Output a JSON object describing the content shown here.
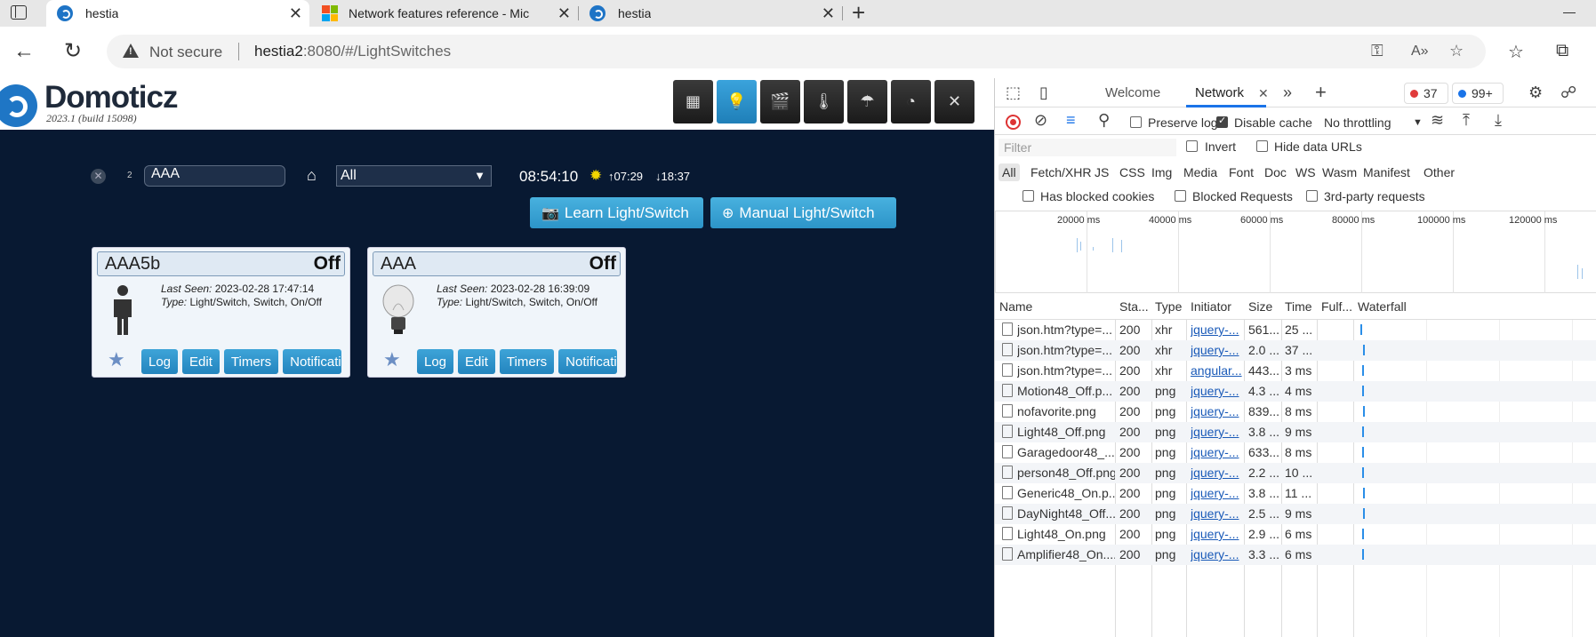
{
  "browser": {
    "tabs": [
      {
        "title": "hestia",
        "active": true
      },
      {
        "title": "Network features reference - Mic",
        "active": false
      },
      {
        "title": "hestia",
        "active": false
      }
    ],
    "security_label": "Not secure",
    "url_host": "hestia2",
    "url_rest": ":8080/#/LightSwitches"
  },
  "app": {
    "brand": "Domoticz",
    "version": "2023.1 (build 15098)",
    "filter": {
      "count": "2",
      "search_value": "AAA",
      "room_value": "All",
      "clock": "08:54:10",
      "sunrise": "07:29",
      "sunset": "18:37"
    },
    "learn_button": "Learn Light/Switch",
    "manual_button": "Manual Light/Switch",
    "devices": [
      {
        "name": "AAA5b",
        "status": "Off",
        "last_seen_label": "Last Seen:",
        "last_seen": "2023-02-28 17:47:14",
        "type_label": "Type:",
        "type": "Light/Switch, Switch, On/Off",
        "icon": "person-icon"
      },
      {
        "name": "AAA",
        "status": "Off",
        "last_seen_label": "Last Seen:",
        "last_seen": "2023-02-28 16:39:09",
        "type_label": "Type:",
        "type": "Light/Switch, Switch, On/Off",
        "icon": "light-bulb-icon"
      }
    ],
    "device_buttons": {
      "log": "Log",
      "edit": "Edit",
      "timers": "Timers",
      "notifications": "Notificati"
    }
  },
  "devtools": {
    "tabs": {
      "welcome": "Welcome",
      "network": "Network"
    },
    "errors": "37",
    "infos": "99+",
    "toolbar": {
      "preserve_log": "Preserve log",
      "disable_cache": "Disable cache",
      "throttling": "No throttling"
    },
    "filter_placeholder": "Filter",
    "invert": "Invert",
    "hide_data_urls": "Hide data URLs",
    "type_filters": [
      "All",
      "Fetch/XHR",
      "JS",
      "CSS",
      "Img",
      "Media",
      "Font",
      "Doc",
      "WS",
      "Wasm",
      "Manifest",
      "Other"
    ],
    "blocked_cookies": "Has blocked cookies",
    "blocked_requests": "Blocked Requests",
    "third_party": "3rd-party requests",
    "overview_ticks": [
      "20000 ms",
      "40000 ms",
      "60000 ms",
      "80000 ms",
      "100000 ms",
      "120000 ms"
    ],
    "columns": {
      "name": "Name",
      "status": "Sta...",
      "type": "Type",
      "initiator": "Initiator",
      "size": "Size",
      "time": "Time",
      "fulfilled": "Fulf...",
      "waterfall": "Waterfall"
    },
    "rows": [
      {
        "name": "json.htm?type=...",
        "status": "200",
        "type": "xhr",
        "initiator": "jquery-...",
        "size": "561...",
        "time": "25 ..."
      },
      {
        "name": "json.htm?type=...",
        "status": "200",
        "type": "xhr",
        "initiator": "jquery-...",
        "size": "2.0 ...",
        "time": "37 ..."
      },
      {
        "name": "json.htm?type=...",
        "status": "200",
        "type": "xhr",
        "initiator": "angular...",
        "size": "443...",
        "time": "3 ms"
      },
      {
        "name": "Motion48_Off.p...",
        "status": "200",
        "type": "png",
        "initiator": "jquery-...",
        "size": "4.3 ...",
        "time": "4 ms"
      },
      {
        "name": "nofavorite.png",
        "status": "200",
        "type": "png",
        "initiator": "jquery-...",
        "size": "839...",
        "time": "8 ms"
      },
      {
        "name": "Light48_Off.png",
        "status": "200",
        "type": "png",
        "initiator": "jquery-...",
        "size": "3.8 ...",
        "time": "9 ms"
      },
      {
        "name": "Garagedoor48_...",
        "status": "200",
        "type": "png",
        "initiator": "jquery-...",
        "size": "633...",
        "time": "8 ms"
      },
      {
        "name": "person48_Off.png",
        "status": "200",
        "type": "png",
        "initiator": "jquery-...",
        "size": "2.2 ...",
        "time": "10 ..."
      },
      {
        "name": "Generic48_On.p...",
        "status": "200",
        "type": "png",
        "initiator": "jquery-...",
        "size": "3.8 ...",
        "time": "11 ..."
      },
      {
        "name": "DayNight48_Off....",
        "status": "200",
        "type": "png",
        "initiator": "jquery-...",
        "size": "2.5 ...",
        "time": "9 ms"
      },
      {
        "name": "Light48_On.png",
        "status": "200",
        "type": "png",
        "initiator": "jquery-...",
        "size": "2.9 ...",
        "time": "6 ms"
      },
      {
        "name": "Amplifier48_On....",
        "status": "200",
        "type": "png",
        "initiator": "jquery-...",
        "size": "3.3 ...",
        "time": "6 ms"
      }
    ]
  }
}
